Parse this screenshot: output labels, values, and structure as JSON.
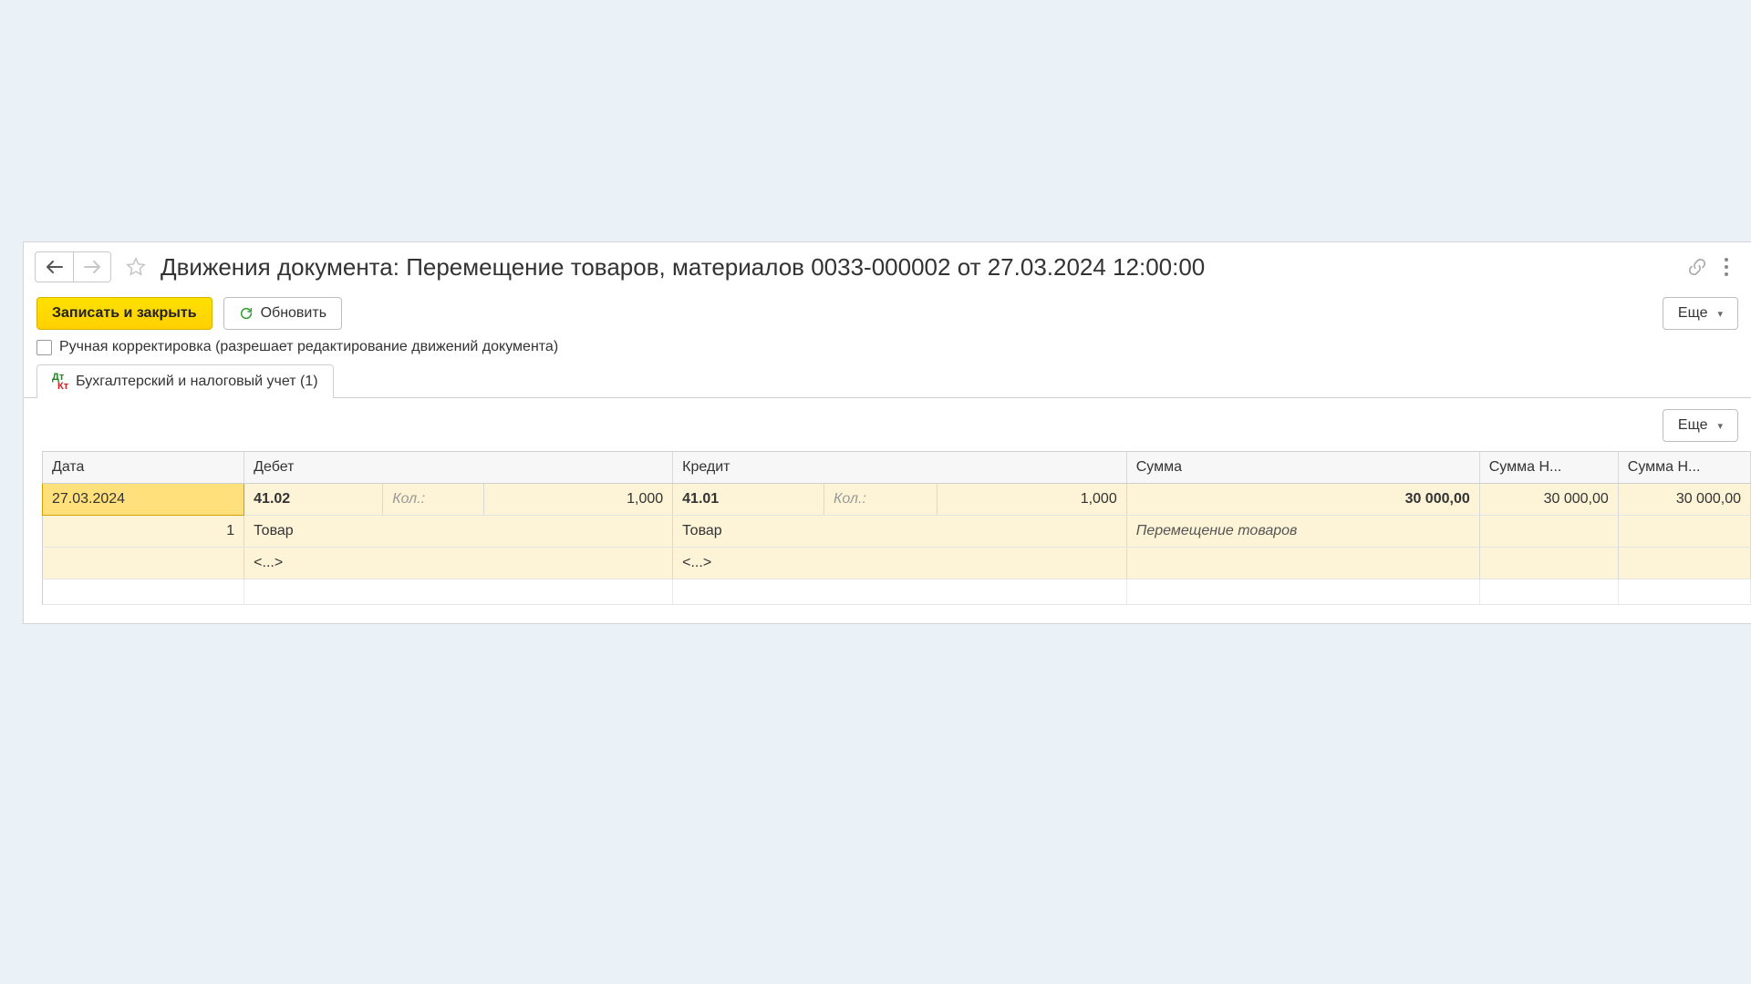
{
  "title": "Движения документа: Перемещение товаров, материалов 0033-000002 от 27.03.2024 12:00:00",
  "toolbar": {
    "save_close": "Записать и закрыть",
    "refresh": "Обновить",
    "more": "Еще"
  },
  "checkbox": {
    "manual_edit": "Ручная корректировка (разрешает редактирование движений документа)"
  },
  "tab": {
    "accounting": "Бухгалтерский и налоговый учет (1)"
  },
  "columns": {
    "date": "Дата",
    "debit": "Дебет",
    "credit": "Кредит",
    "sum": "Сумма",
    "sum_n1": "Сумма Н...",
    "sum_n2": "Сумма Н..."
  },
  "row": {
    "date": "27.03.2024",
    "num": "1",
    "debit_account": "41.02",
    "debit_qty_label": "Кол.:",
    "debit_qty": "1,000",
    "debit_item": "Товар",
    "debit_extra": "<...>",
    "credit_account": "41.01",
    "credit_qty_label": "Кол.:",
    "credit_qty": "1,000",
    "credit_item": "Товар",
    "credit_extra": "<...>",
    "sum": "30 000,00",
    "sum_desc": "Перемещение товаров",
    "sum_n1": "30 000,00",
    "sum_n2": "30 000,00"
  }
}
